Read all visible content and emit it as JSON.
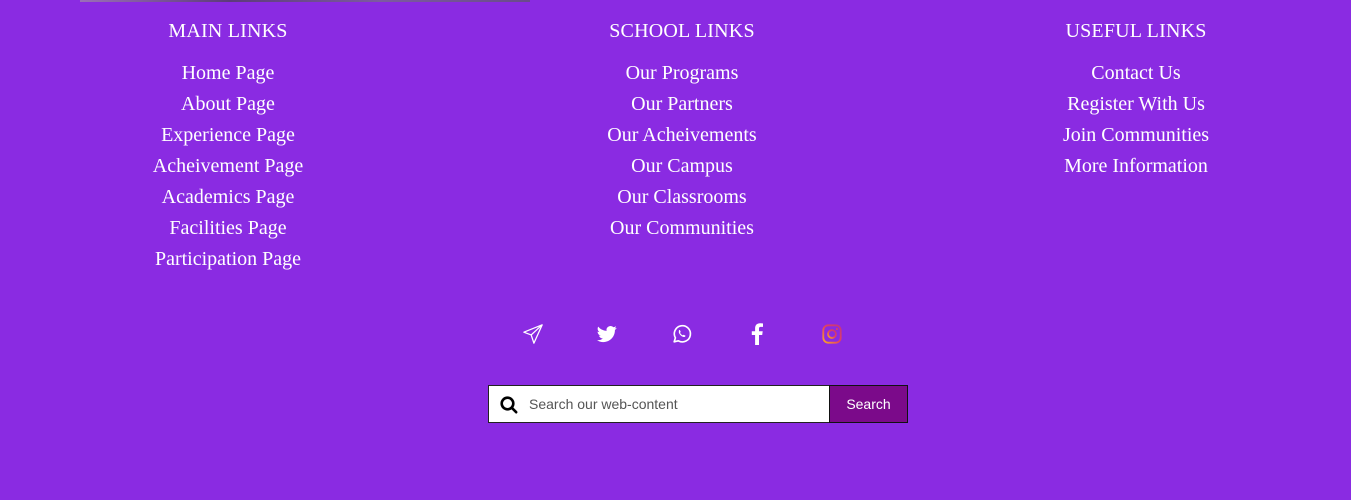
{
  "main_links": {
    "title": "MAIN LINKS",
    "items": [
      "Home Page",
      "About Page",
      "Experience Page",
      "Acheivement Page",
      "Academics Page",
      "Facilities Page",
      "Participation Page"
    ]
  },
  "school_links": {
    "title": "SCHOOL LINKS",
    "items": [
      "Our Programs",
      "Our Partners",
      "Our Acheivements",
      "Our Campus",
      "Our Classrooms",
      "Our Communities"
    ]
  },
  "useful_links": {
    "title": "USEFUL LINKS",
    "items": [
      "Contact Us",
      "Register With Us",
      "Join Communities",
      "More Information"
    ]
  },
  "social": {
    "icons": [
      "telegram-icon",
      "twitter-icon",
      "whatsapp-icon",
      "facebook-icon",
      "instagram-icon"
    ]
  },
  "search": {
    "placeholder": "Search our web-content",
    "button_label": "Search"
  },
  "colors": {
    "background": "#8a2be2",
    "search_button": "#7b0a8a",
    "text": "#ffffff"
  }
}
